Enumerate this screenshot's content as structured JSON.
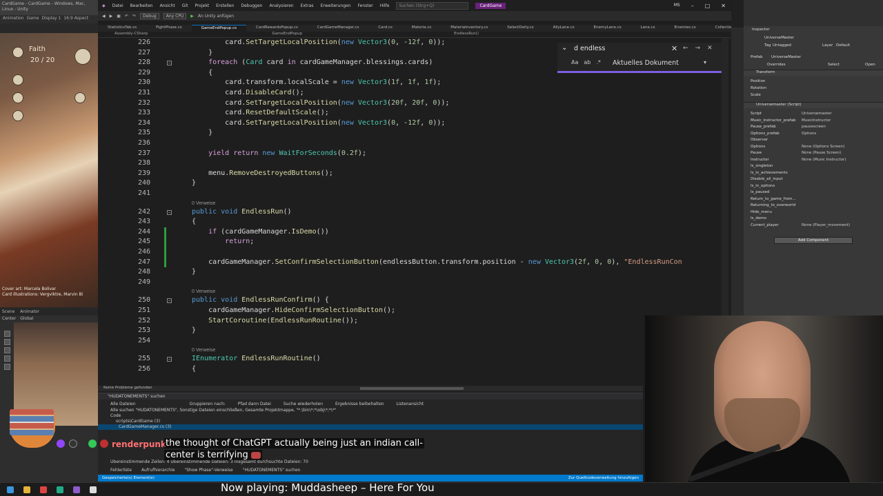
{
  "unity_left": {
    "title_bar": "CardGame - CardGame - Windows, Mac, Linux - Unity",
    "tabs": [
      "Animation",
      "Game"
    ],
    "display": "Display 1",
    "aspect": "16:9 Aspect",
    "faith_label": "Faith",
    "hp_value": "20 / 20",
    "cover_art": "Cover art: Marcela Bolivar",
    "card_illustrations": "Card illustrations: Vergviktre, Marvin Bi",
    "scene_tabs": [
      "Scene",
      "Animator"
    ],
    "scene_mode": "Center",
    "scene_space": "Global"
  },
  "vs": {
    "menu": [
      "Datei",
      "Bearbeiten",
      "Ansicht",
      "Git",
      "Projekt",
      "Erstellen",
      "Debuggen",
      "Analysieren",
      "Extras",
      "Erweiterungen",
      "Fenster",
      "Hilfe"
    ],
    "search_placeholder": "Suchen (Strg+Q)",
    "project_name": "CardGame",
    "user_initials": "MS",
    "toolbar": {
      "config": "Debug",
      "platform": "Any CPU",
      "attach": "An Unity anfügen"
    },
    "file_tabs": [
      "StatisticsTab.cs",
      "FightPhase.cs",
      "GameEndPopup.cs",
      "CardRewardsPopup.cs",
      "CardGameManager.cs",
      "Card.cs",
      "Materia.cs",
      "MateriaInventory.cs",
      "SelectDeity.cs",
      "AllyLane.cs",
      "EnemyLane.cs",
      "Lane.cs",
      "Enemies.cs",
      "Collection.cs"
    ],
    "active_tab": "GameEndPopup.cs",
    "nav": {
      "assembly": "Assembly-CSharp",
      "class": "GameEndPopup",
      "member": "EndlessRun()"
    },
    "find": {
      "query": "d endless",
      "scope": "Aktuelles Dokument"
    },
    "refs_label": "0 Verweise",
    "status_left": "Keine Probleme gefunden"
  },
  "code_lines": [
    {
      "n": "226",
      "code": "        card.SetTargetLocalPosition(new Vector3(0, -12f, 0));"
    },
    {
      "n": "227",
      "code": "    }"
    },
    {
      "n": "228",
      "code": "    foreach (Card card in cardGameManager.blessings.cards)"
    },
    {
      "n": "229",
      "code": "    {"
    },
    {
      "n": "230",
      "code": "        card.transform.localScale = new Vector3(1f, 1f, 1f);"
    },
    {
      "n": "231",
      "code": "        card.DisableCard();"
    },
    {
      "n": "232",
      "code": "        card.SetTargetLocalPosition(new Vector3(20f, 20f, 0));"
    },
    {
      "n": "233",
      "code": "        card.ResetDefaultScale();"
    },
    {
      "n": "234",
      "code": "        card.SetTargetLocalPosition(new Vector3(0, -12f, 0));"
    },
    {
      "n": "235",
      "code": "    }"
    },
    {
      "n": "236",
      "code": ""
    },
    {
      "n": "237",
      "code": "    yield return new WaitForSeconds(0.2f);"
    },
    {
      "n": "238",
      "code": ""
    },
    {
      "n": "239",
      "code": "    menu.RemoveDestroyedButtons();"
    },
    {
      "n": "240",
      "code": "}"
    },
    {
      "n": "241",
      "code": ""
    },
    {
      "n": "242",
      "code": "public void EndlessRun()"
    },
    {
      "n": "243",
      "code": "{"
    },
    {
      "n": "244",
      "code": "    if (cardGameManager.IsDemo())"
    },
    {
      "n": "245",
      "code": "        return;"
    },
    {
      "n": "246",
      "code": ""
    },
    {
      "n": "247",
      "code": "    cardGameManager.SetConfirmSelectionButton(endlessButton.transform.position - new Vector3(2f, 0, 0), \"EndlessRunCon"
    },
    {
      "n": "248",
      "code": "}"
    },
    {
      "n": "249",
      "code": ""
    },
    {
      "n": "250",
      "code": "public void EndlessRunConfirm() {"
    },
    {
      "n": "251",
      "code": "    cardGameManager.HideConfirmSelectionButton();"
    },
    {
      "n": "252",
      "code": "    StartCoroutine(EndlessRunRoutine());"
    },
    {
      "n": "253",
      "code": "}"
    },
    {
      "n": "254",
      "code": ""
    },
    {
      "n": "255",
      "code": "IEnumerator EndlessRunRoutine()"
    },
    {
      "n": "256",
      "code": "{"
    }
  ],
  "results": {
    "header": "\"HUDATONEMENTS\" suchen",
    "scope": "Alle Dateien",
    "group_label": "Gruppieren nach:",
    "group_value": "Pfad dann Datei",
    "repeat": "Suche wiederholen",
    "keep": "Ergebnisse beibehalten",
    "list_view": "Listenansicht",
    "summary": "Alle suchen \"HUDATONEMENTS\", Sonstige Dateien einschließen, Gesamte Projektmappe, \"*.\\bin\\*;*\\obj\\*;*\\*\"",
    "code_label": "Code",
    "item1": "scripts\\CardGame (3)",
    "item2": "CardGameManager.cs (3)",
    "footer_stats": "Übereinstimmende Zeilen: 4  Übereinstimmende Dateien: 3  Insgesamt durchsuchte Dateien: 70",
    "footer_tabs": [
      "Fehlerliste",
      "Aufrufhierarchie",
      "\"Show Phase\"-Verweise",
      "\"HUDATONEMENTS\" suchen"
    ],
    "saved": "Gespeicherte(s) Element(e)",
    "scm": "Zur Quellcodeverwaltung hinzufügen"
  },
  "chat": {
    "user": "renderpunk",
    "message_line1": "the thought of ChatGPT actually being just an indian call-",
    "message_line2": "center is terrifying"
  },
  "inspector": {
    "title": "Inspector",
    "object_name": "UniverseMaster",
    "tag_label": "Tag",
    "tag_value": "Untagged",
    "layer_label": "Layer",
    "layer_value": "Default",
    "prefab_label": "Prefab",
    "prefab_value": "UniverseMaster",
    "overrides": "Overrides",
    "select": "Select",
    "open": "Open",
    "transform": "Transform",
    "position": "Position",
    "rotation": "Rotation",
    "scale": "Scale",
    "script_title": "Universemaster (Script)",
    "fields": [
      {
        "k": "Script",
        "v": "Universemaster"
      },
      {
        "k": "Music_instructor_prefab",
        "v": "MusicInstructor"
      },
      {
        "k": "Pause_prefab",
        "v": "pausescreen"
      },
      {
        "k": "Options_prefab",
        "v": "Options"
      },
      {
        "k": "Observer",
        "v": ""
      },
      {
        "k": "Options",
        "v": "None (Options Screen)"
      },
      {
        "k": "Pause",
        "v": "None (Pause Screen)"
      },
      {
        "k": "Instructor",
        "v": "None (Music Instructor)"
      },
      {
        "k": "Is_singleton",
        "v": ""
      },
      {
        "k": "Is_in_achievements",
        "v": ""
      },
      {
        "k": "Disable_all_input",
        "v": ""
      },
      {
        "k": "Is_in_options",
        "v": ""
      },
      {
        "k": "Is_paused",
        "v": ""
      },
      {
        "k": "Return_to_game_from...",
        "v": ""
      },
      {
        "k": "Returning_to_overworld",
        "v": ""
      },
      {
        "k": "Hide_menu",
        "v": ""
      },
      {
        "k": "Is_demo",
        "v": ""
      },
      {
        "k": "Current_player",
        "v": "None (Player_movement)"
      }
    ],
    "add_component": "Add Component"
  },
  "now_playing": "Now playing: Muddasheep – Here For You",
  "colors": {
    "keyword": "#569cd6",
    "type": "#4ec9b0",
    "method": "#dcdcaa",
    "number": "#b5cea8",
    "string": "#d69d85",
    "find_accent": "#7f5fe0",
    "status_bar": "#007acc"
  }
}
